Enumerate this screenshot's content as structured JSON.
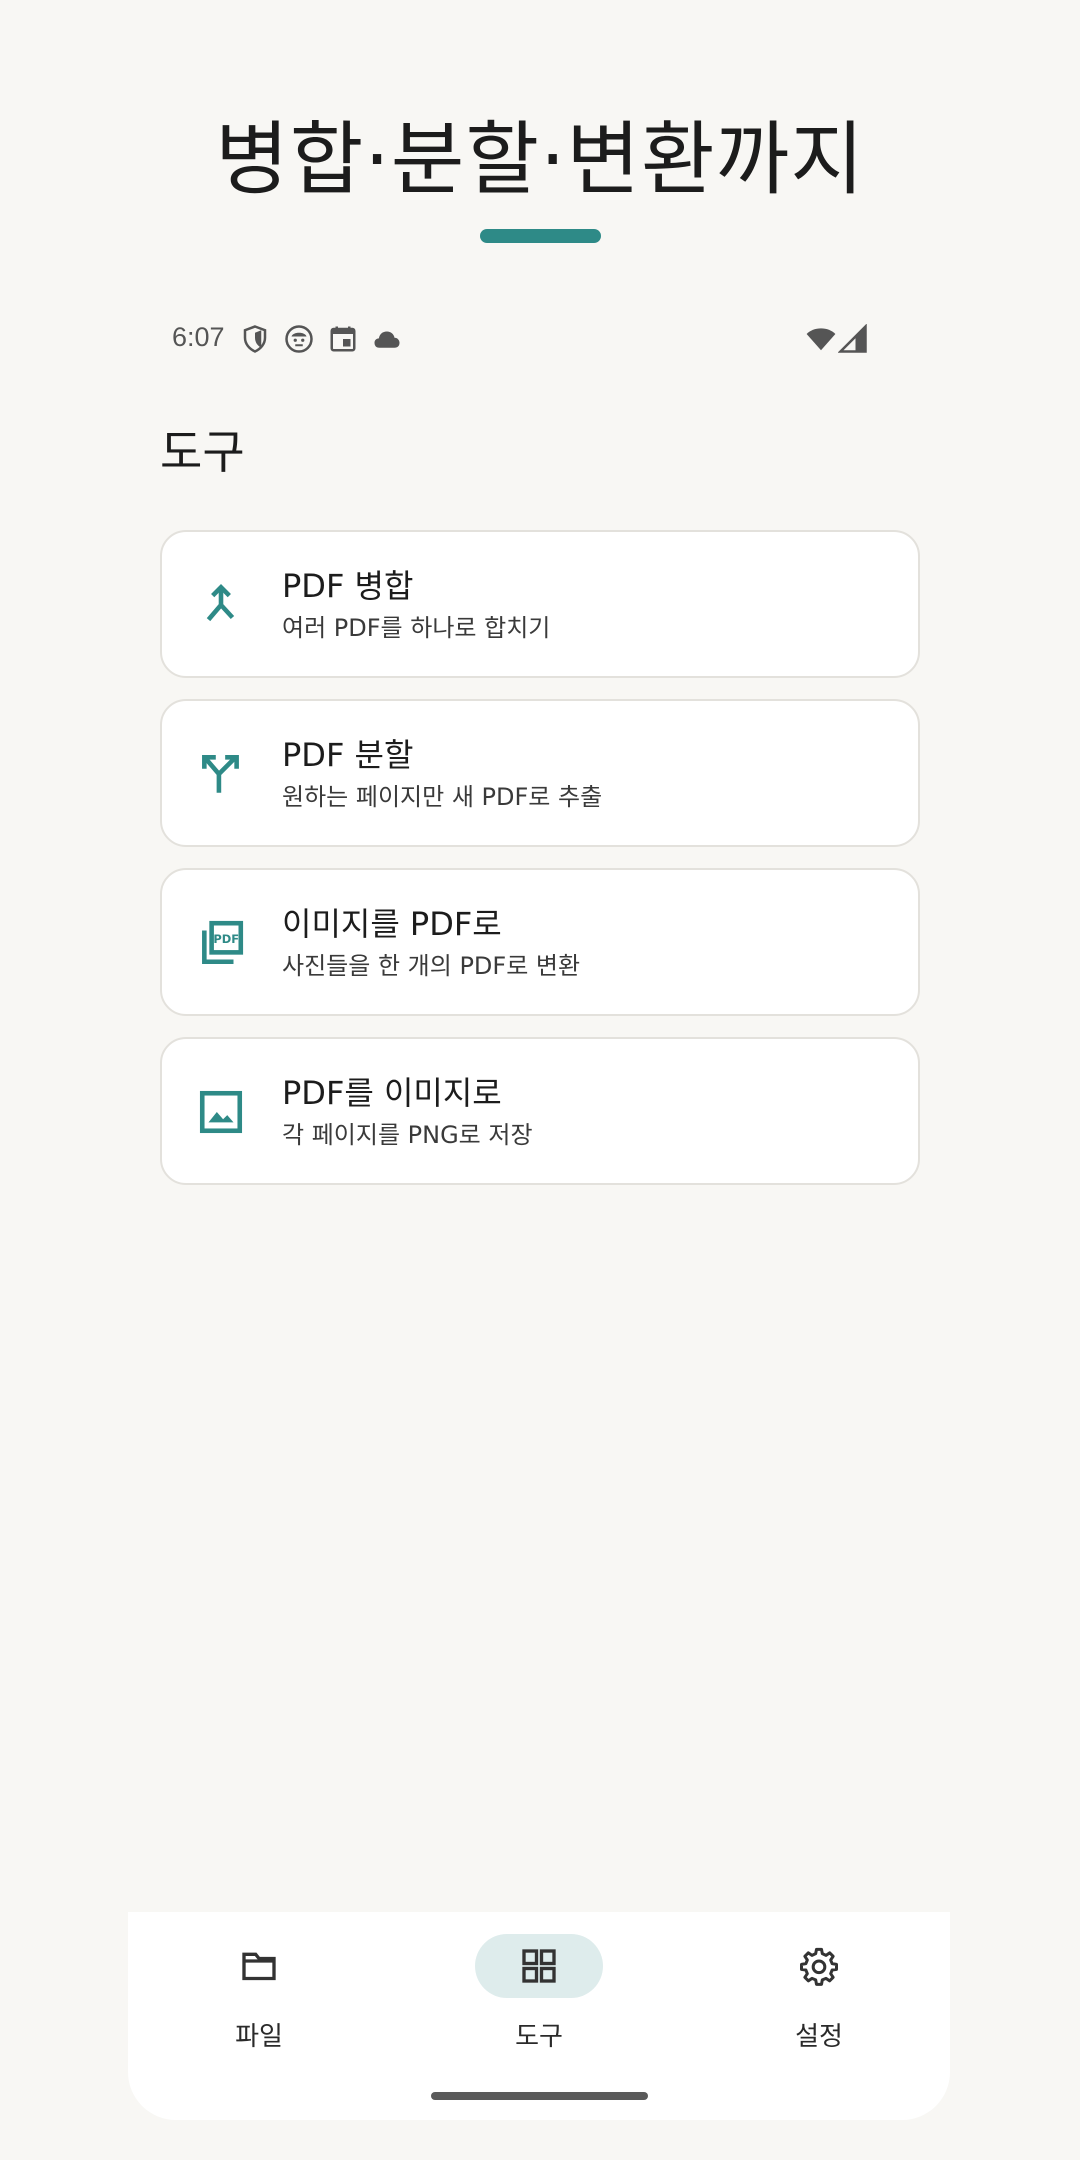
{
  "banner": {
    "title": "병합·분할·변환까지",
    "accent_color": "#2e8a87"
  },
  "status_bar": {
    "time": "6:07",
    "left_icons": [
      "shield-icon",
      "face-icon",
      "calendar-icon",
      "cloud-icon"
    ],
    "right_icons": [
      "wifi-icon",
      "signal-icon"
    ]
  },
  "section": {
    "title": "도구"
  },
  "tools": [
    {
      "title": "PDF 병합",
      "subtitle": "여러 PDF를 하나로 합치기",
      "icon": "merge-icon"
    },
    {
      "title": "PDF 분할",
      "subtitle": "원하는 페이지만 새 PDF로 추출",
      "icon": "split-icon"
    },
    {
      "title": "이미지를 PDF로",
      "subtitle": "사진들을 한 개의 PDF로 변환",
      "icon": "image-to-pdf-icon"
    },
    {
      "title": "PDF를 이미지로",
      "subtitle": "각 페이지를 PNG로 저장",
      "icon": "image-icon"
    }
  ],
  "bottom_nav": {
    "items": [
      {
        "label": "파일",
        "icon": "folder-icon",
        "active": false
      },
      {
        "label": "도구",
        "icon": "grid-icon",
        "active": true
      },
      {
        "label": "설정",
        "icon": "gear-icon",
        "active": false
      }
    ]
  },
  "colors": {
    "accent": "#2e8a87",
    "background": "#f8f7f4",
    "card": "#ffffff",
    "nav_active_pill": "#deecec"
  }
}
